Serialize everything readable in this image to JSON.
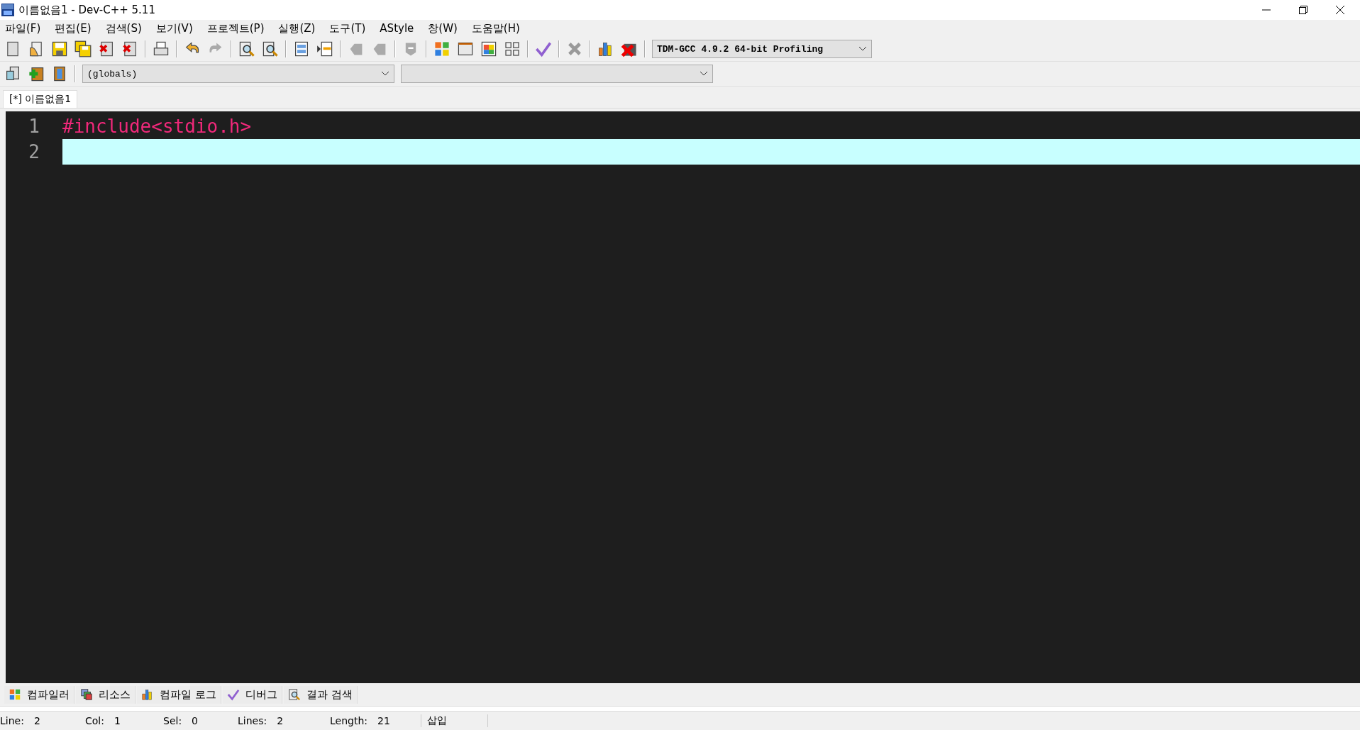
{
  "window": {
    "title": "이름없음1 - Dev-C++ 5.11"
  },
  "menu": [
    "파일(F)",
    "편집(E)",
    "검색(S)",
    "보기(V)",
    "프로젝트(P)",
    "실행(Z)",
    "도구(T)",
    "AStyle",
    "창(W)",
    "도움말(H)"
  ],
  "compiler_select": {
    "value": "TDM-GCC 4.9.2 64-bit Profiling"
  },
  "class_select": {
    "value": "(globals)"
  },
  "tabs": [
    {
      "label": "[*] 이름없음1",
      "selected": true
    }
  ],
  "editor": {
    "lines": [
      {
        "number": "1",
        "code": "#include<stdio.h>",
        "current": false
      },
      {
        "number": "2",
        "current": true
      }
    ]
  },
  "bottom_tabs": [
    {
      "label": "컴파일러"
    },
    {
      "label": "리소스"
    },
    {
      "label": "컴파일 로그"
    },
    {
      "label": "디버그"
    },
    {
      "label": "결과 검색"
    }
  ],
  "status_bar": [
    {
      "label": "Line:",
      "value": "2"
    },
    {
      "label": "Col:",
      "value": "1"
    },
    {
      "label": "Sel:",
      "value": "0"
    },
    {
      "label": "Lines:",
      "value": "2"
    },
    {
      "label": "Length:",
      "value": "21"
    }
  ],
  "status_mode": "삽입"
}
